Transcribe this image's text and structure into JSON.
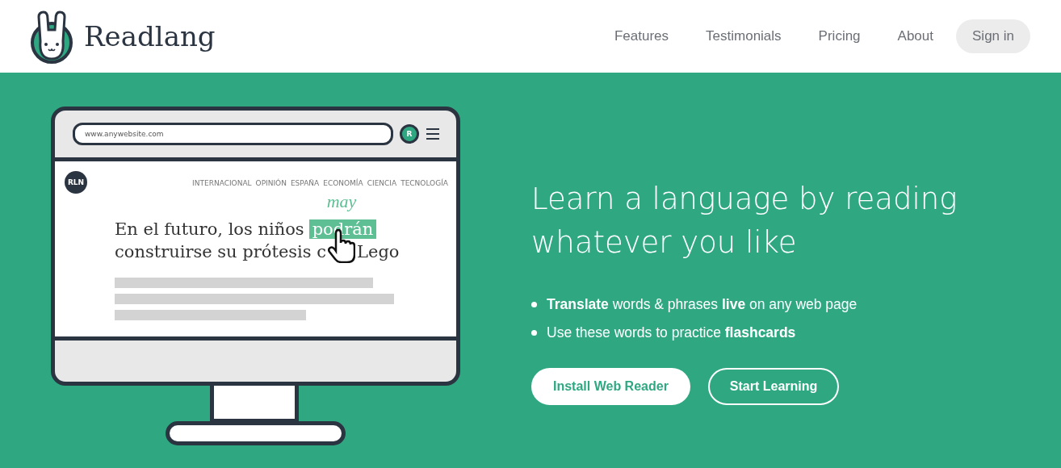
{
  "header": {
    "brand": "Readlang",
    "nav": [
      "Features",
      "Testimonials",
      "Pricing",
      "About"
    ],
    "sign_in": "Sign in"
  },
  "illustration": {
    "url": "www.anywebsite.com",
    "avatar": "R",
    "site_logo": "RLN",
    "sections": [
      "INTERNACIONAL",
      "OPINIÓN",
      "ESPAÑA",
      "ECONOMÍA",
      "CIENCIA",
      "TECNOLOGÍA"
    ],
    "translation": "may",
    "headline_start": "En el futuro, los niños",
    "highlight": "podrán",
    "headline_line2": "construirse su prótesis c",
    "headline_end": "Lego"
  },
  "hero": {
    "title": "Learn a language by reading whatever you like",
    "bullets": [
      "**Translate** words & phrases **live** on any web page",
      "Use these words to practice **flashcards**"
    ],
    "buttons": [
      {
        "label": "Install Web Reader",
        "kind": "solid"
      },
      {
        "label": "Start Learning",
        "kind": "outline"
      }
    ]
  }
}
